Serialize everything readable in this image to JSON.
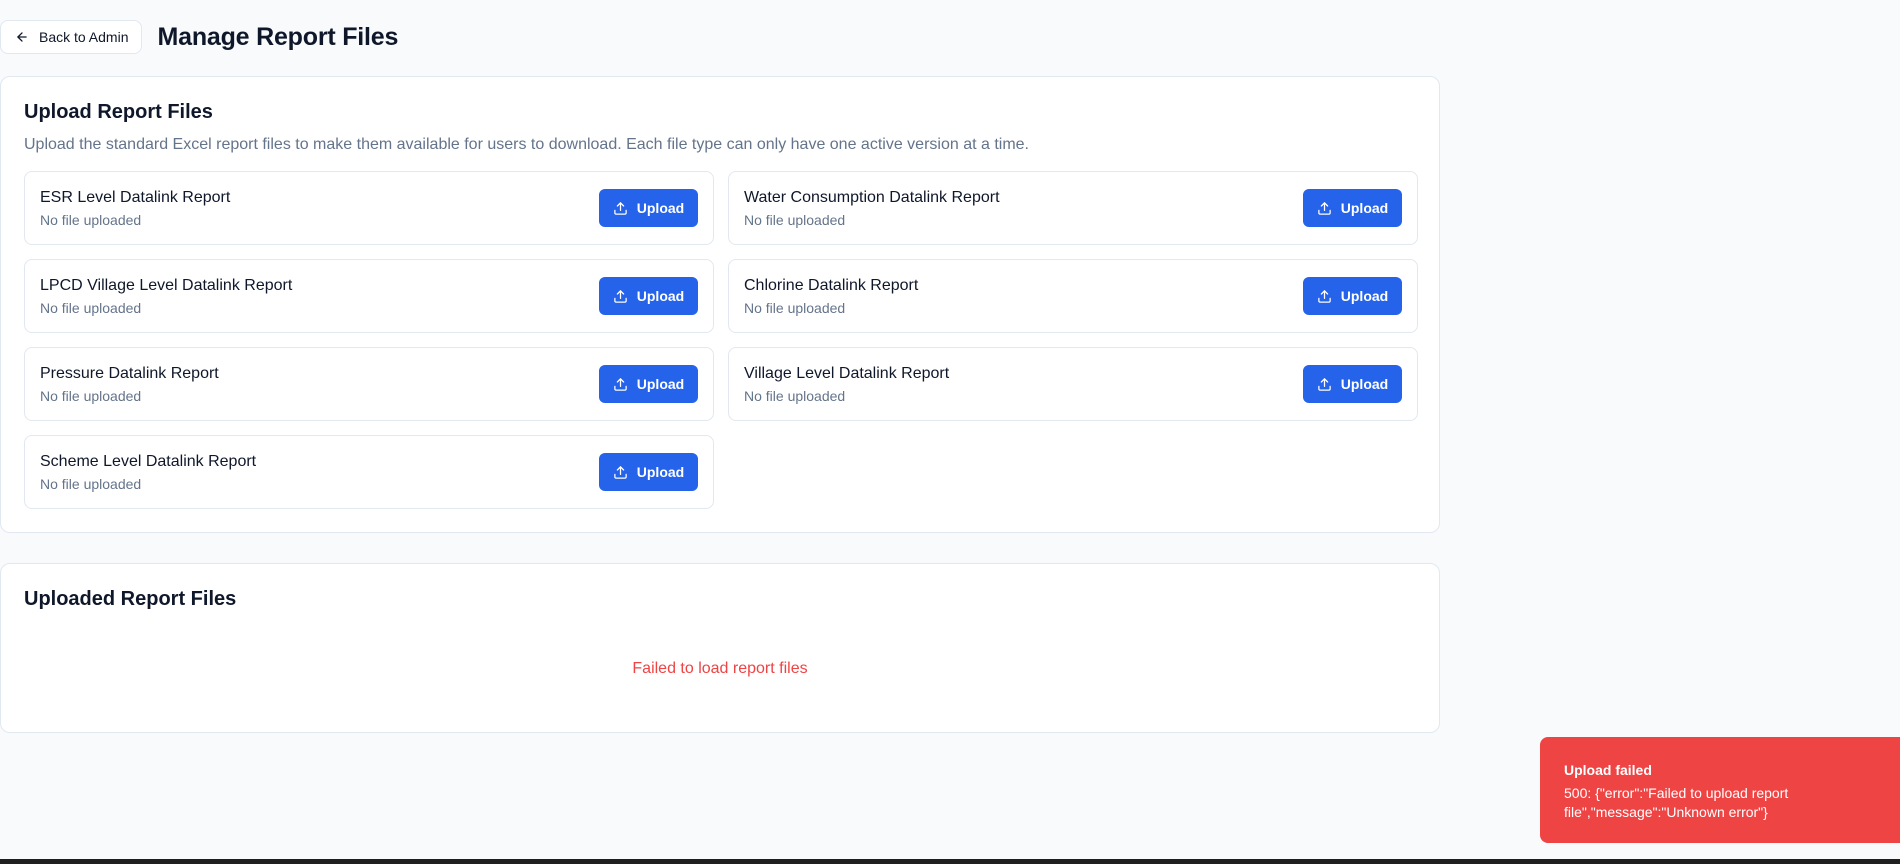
{
  "header": {
    "back_label": "Back to Admin",
    "title": "Manage Report Files"
  },
  "upload_section": {
    "title": "Upload Report Files",
    "description": "Upload the standard Excel report files to make them available for users to download. Each file type can only have one active version at a time.",
    "reports": [
      {
        "name": "ESR Level Datalink Report",
        "status": "No file uploaded",
        "button_label": "Upload"
      },
      {
        "name": "Water Consumption Datalink Report",
        "status": "No file uploaded",
        "button_label": "Upload"
      },
      {
        "name": "LPCD Village Level Datalink Report",
        "status": "No file uploaded",
        "button_label": "Upload"
      },
      {
        "name": "Chlorine Datalink Report",
        "status": "No file uploaded",
        "button_label": "Upload"
      },
      {
        "name": "Pressure Datalink Report",
        "status": "No file uploaded",
        "button_label": "Upload"
      },
      {
        "name": "Village Level Datalink Report",
        "status": "No file uploaded",
        "button_label": "Upload"
      },
      {
        "name": "Scheme Level Datalink Report",
        "status": "No file uploaded",
        "button_label": "Upload"
      }
    ]
  },
  "uploaded_section": {
    "title": "Uploaded Report Files",
    "error": "Failed to load report files"
  },
  "toast": {
    "title": "Upload failed",
    "message": "500: {\"error\":\"Failed to upload report file\",\"message\":\"Unknown error\"}"
  },
  "icons": {
    "back": "arrow-left-icon",
    "upload": "upload-icon"
  },
  "colors": {
    "primary": "#2563eb",
    "error": "#ef4444",
    "muted_text": "#64748b",
    "border": "#e2e8f0",
    "background": "#f8fafc"
  }
}
